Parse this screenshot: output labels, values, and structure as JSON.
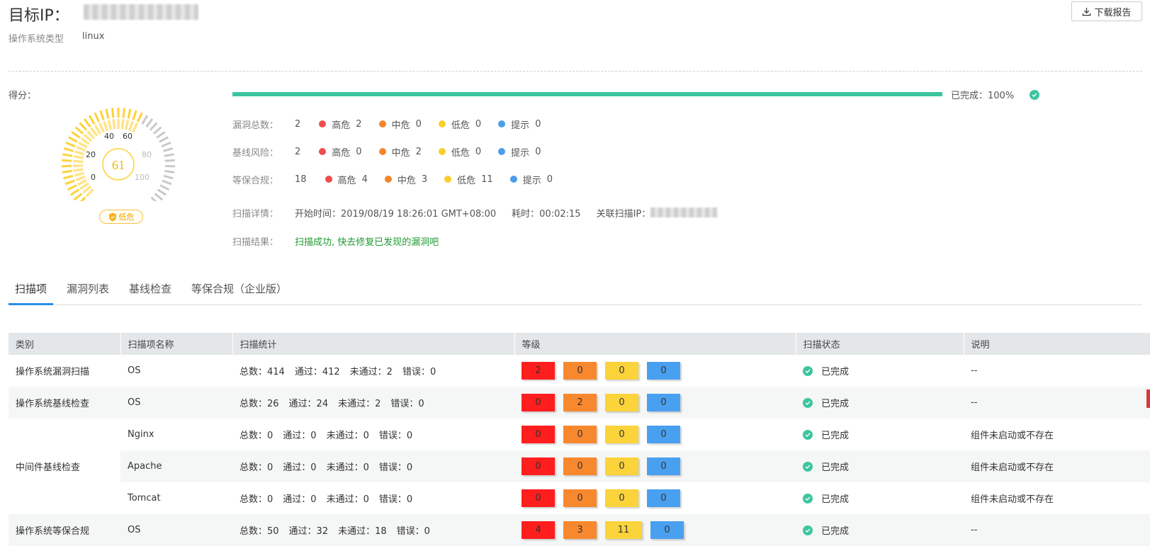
{
  "header": {
    "target_label": "目标IP：",
    "os_label": "操作系统类型",
    "os_value": "linux",
    "download_label": "下载报告"
  },
  "score": {
    "label": "得分：",
    "value": "61",
    "risk_badge": "低危",
    "gauge_ticks": [
      "0",
      "20",
      "40",
      "60",
      "80",
      "100"
    ]
  },
  "progress": {
    "label": "已完成：100%",
    "percent": 100
  },
  "stats": {
    "vuln": {
      "label": "漏洞总数：",
      "total": "2",
      "high": "2",
      "mid": "0",
      "low": "0",
      "info": "0"
    },
    "baseline": {
      "label": "基线风险：",
      "total": "2",
      "high": "0",
      "mid": "2",
      "low": "0",
      "info": "0"
    },
    "compliance": {
      "label": "等保合规：",
      "total": "18",
      "high": "4",
      "mid": "3",
      "low": "11",
      "info": "0"
    },
    "severity_names": {
      "high": "高危",
      "mid": "中危",
      "low": "低危",
      "info": "提示"
    },
    "detail": {
      "label": "扫描详情：",
      "start": "开始时间：2019/08/19 18:26:01 GMT+08:00",
      "duration": "耗时：00:02:15",
      "related_ip": "关联扫描IP："
    },
    "result": {
      "label": "扫描结果：",
      "text": "扫描成功, 快去修复已发现的漏洞吧"
    }
  },
  "tabs": [
    "扫描项",
    "漏洞列表",
    "基线检查",
    "等保合规（企业版）"
  ],
  "table": {
    "headers": [
      "类别",
      "扫描项名称",
      "扫描统计",
      "等级",
      "扫描状态",
      "说明"
    ],
    "rows": [
      {
        "category": "操作系统漏洞扫描",
        "name": "OS",
        "stats": [
          "总数：414",
          "通过：412",
          "未通过：2",
          "错误：0"
        ],
        "levels": [
          "2",
          "0",
          "0",
          "0"
        ],
        "status": "已完成",
        "note": "--"
      },
      {
        "category": "操作系统基线检查",
        "name": "OS",
        "stats": [
          "总数：26",
          "通过：24",
          "未通过：2",
          "错误：0"
        ],
        "levels": [
          "0",
          "2",
          "0",
          "0"
        ],
        "status": "已完成",
        "note": "--"
      },
      {
        "category": "中间件基线检查",
        "name": "Nginx",
        "stats": [
          "总数：0",
          "通过：0",
          "未通过：0",
          "错误：0"
        ],
        "levels": [
          "0",
          "0",
          "0",
          "0"
        ],
        "status": "已完成",
        "note": "组件未启动或不存在"
      },
      {
        "category": "",
        "name": "Apache",
        "stats": [
          "总数：0",
          "通过：0",
          "未通过：0",
          "错误：0"
        ],
        "levels": [
          "0",
          "0",
          "0",
          "0"
        ],
        "status": "已完成",
        "note": "组件未启动或不存在"
      },
      {
        "category": "",
        "name": "Tomcat",
        "stats": [
          "总数：0",
          "通过：0",
          "未通过：0",
          "错误：0"
        ],
        "levels": [
          "0",
          "0",
          "0",
          "0"
        ],
        "status": "已完成",
        "note": "组件未启动或不存在"
      },
      {
        "category": "操作系统等保合规",
        "name": "OS",
        "stats": [
          "总数：50",
          "通过：32",
          "未通过：18",
          "错误：0"
        ],
        "levels": [
          "4",
          "3",
          "11",
          "0"
        ],
        "status": "已完成",
        "note": "--"
      }
    ]
  },
  "colors": {
    "accent": "#3dc5a0",
    "high": "#f04d4d",
    "mid": "#f5852a",
    "low": "#f7cf2d",
    "info": "#4c9ee8",
    "box_high": "#ff1e1e",
    "box_mid": "#f8882e",
    "box_low": "#fbd33a",
    "box_info": "#4aa0f0"
  }
}
